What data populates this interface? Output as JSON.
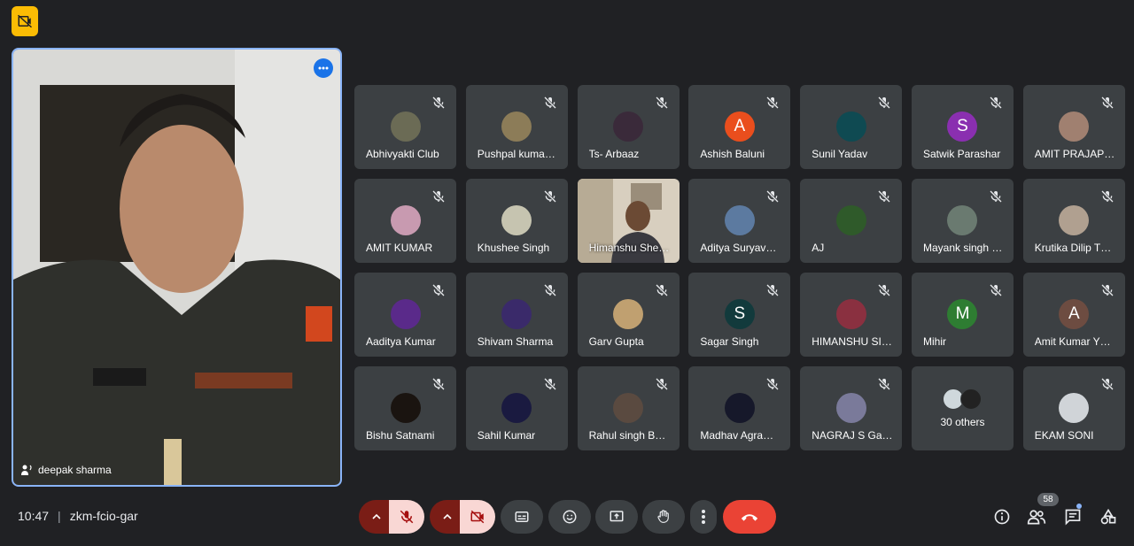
{
  "meeting": {
    "time": "10:47",
    "code": "zkm-fcio-gar"
  },
  "spotlight": {
    "name": "deepak sharma"
  },
  "participants": [
    {
      "name": "Abhivyakti Club",
      "avatar": "#6b6b55",
      "letter": ""
    },
    {
      "name": "Pushpal kuma…",
      "avatar": "#8c7c58",
      "letter": ""
    },
    {
      "name": "Ts- Arbaaz",
      "avatar": "#3a2a3a",
      "letter": ""
    },
    {
      "name": "Ashish Baluni",
      "avatar": "#ea4e1d",
      "letter": "A"
    },
    {
      "name": "Sunil Yadav",
      "avatar": "#0f4a52",
      "letter": ""
    },
    {
      "name": "Satwik Parashar",
      "avatar": "#8a2fb0",
      "letter": "S"
    },
    {
      "name": "AMIT PRAJAP…",
      "avatar": "#a08070",
      "letter": ""
    },
    {
      "name": "AMIT KUMAR",
      "avatar": "#c89ab0",
      "letter": ""
    },
    {
      "name": "Khushee Singh",
      "avatar": "#c6c4b0",
      "letter": ""
    },
    {
      "name": "Himanshu She…",
      "avatar": "#8a8070",
      "letter": "",
      "video": true
    },
    {
      "name": "Aditya Suryav…",
      "avatar": "#5c7aa0",
      "letter": ""
    },
    {
      "name": "AJ",
      "avatar": "#2f5a2a",
      "letter": ""
    },
    {
      "name": "Mayank singh …",
      "avatar": "#6a7a70",
      "letter": ""
    },
    {
      "name": "Krutika Dilip T…",
      "avatar": "#b0a090",
      "letter": ""
    },
    {
      "name": "Aaditya Kumar",
      "avatar": "#5a2a8a",
      "letter": ""
    },
    {
      "name": "Shivam Sharma",
      "avatar": "#3a2a6a",
      "letter": ""
    },
    {
      "name": "Garv Gupta",
      "avatar": "#c0a070",
      "letter": ""
    },
    {
      "name": "Sagar Singh",
      "avatar": "#123a3c",
      "letter": "S"
    },
    {
      "name": "HIMANSHU SI…",
      "avatar": "#8a3040",
      "letter": ""
    },
    {
      "name": "Mihir",
      "avatar": "#2e7d32",
      "letter": "M"
    },
    {
      "name": "Amit Kumar Y…",
      "avatar": "#6d4c41",
      "letter": "A"
    },
    {
      "name": "Bishu Satnami",
      "avatar": "#1a1410",
      "letter": ""
    },
    {
      "name": "Sahil Kumar",
      "avatar": "#1a1a40",
      "letter": ""
    },
    {
      "name": "Rahul singh B…",
      "avatar": "#5a4a40",
      "letter": ""
    },
    {
      "name": "Madhav Agra…",
      "avatar": "#16182a",
      "letter": ""
    },
    {
      "name": "NAGRAJ S Ga…",
      "avatar": "#7a7a9a",
      "letter": ""
    },
    {
      "name": "30 others",
      "avatar": "#999",
      "letter": "",
      "others": true
    },
    {
      "name": "EKAM SONI",
      "avatar": "#d0d4d8",
      "letter": ""
    }
  ],
  "people_count": "58",
  "colors": {
    "accent": "#8ab4f8",
    "end_call": "#ea4335",
    "control_bg": "#3c4043"
  }
}
